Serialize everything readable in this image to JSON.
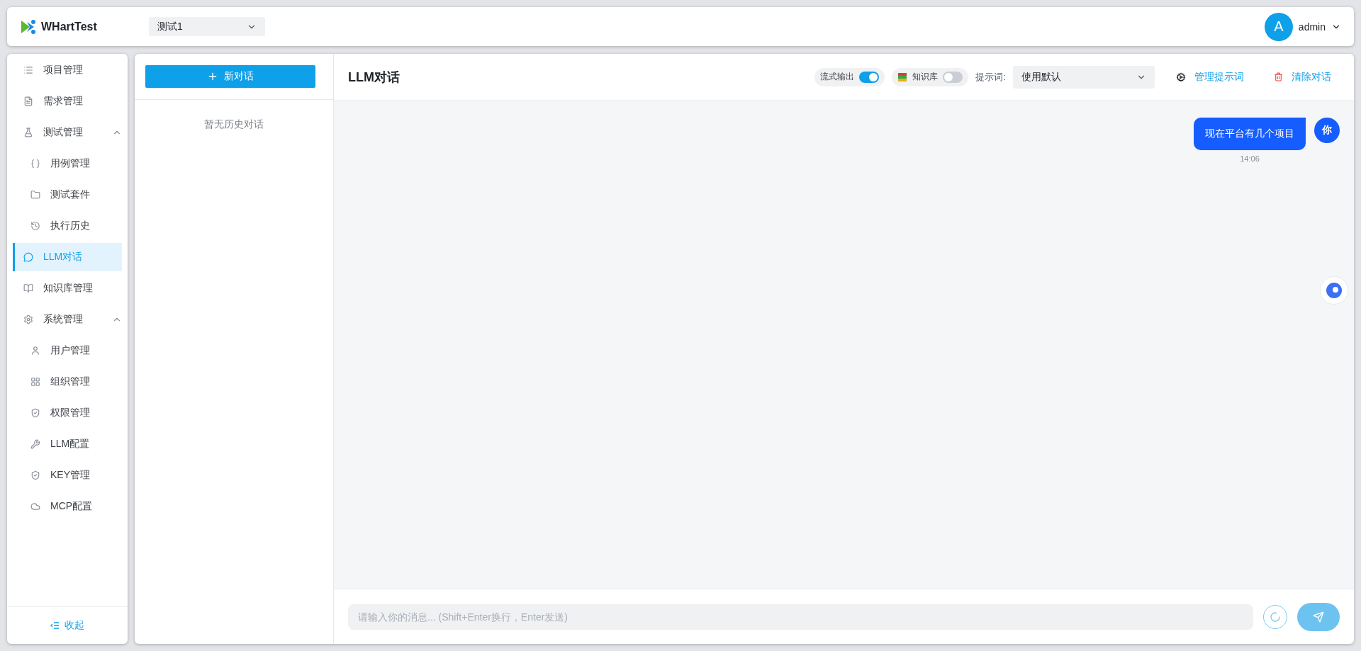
{
  "header": {
    "app_name": "WHartTest",
    "project_select": {
      "value": "测试1"
    },
    "user": {
      "avatar": "A",
      "name": "admin"
    }
  },
  "sidebar": {
    "items": [
      {
        "label": "项目管理",
        "selected": false
      },
      {
        "label": "需求管理",
        "selected": false
      },
      {
        "label": "测试管理",
        "selected": false,
        "expanded": true,
        "children": [
          {
            "label": "用例管理",
            "selected": false
          },
          {
            "label": "测试套件",
            "selected": false
          },
          {
            "label": "执行历史",
            "selected": false
          }
        ]
      },
      {
        "label": "LLM对话",
        "selected": true
      },
      {
        "label": "知识库管理",
        "selected": false
      },
      {
        "label": "系统管理",
        "selected": false,
        "expanded": true,
        "children": [
          {
            "label": "用户管理",
            "selected": false
          },
          {
            "label": "组织管理",
            "selected": false
          },
          {
            "label": "权限管理",
            "selected": false
          },
          {
            "label": "LLM配置",
            "selected": false
          },
          {
            "label": "KEY管理",
            "selected": false
          },
          {
            "label": "MCP配置",
            "selected": false
          }
        ]
      }
    ],
    "collapse_label": "收起"
  },
  "history": {
    "new_button": "新对话",
    "empty_text": "暂无历史对话"
  },
  "chat": {
    "title": "LLM对话",
    "stream_toggle": {
      "label": "流式输出",
      "on": true
    },
    "knowledge_toggle": {
      "label": "知识库",
      "on": false
    },
    "prompt_label": "提示词:",
    "prompt_select": {
      "value": "使用默认"
    },
    "manage_prompts": "管理提示词",
    "clear_chat": "清除对话",
    "messages": [
      {
        "text": "现在平台有几个项目",
        "time": "14:06",
        "sender": "你"
      }
    ],
    "input": {
      "placeholder": "请输入你的消息... (Shift+Enter换行，Enter发送)"
    }
  }
}
